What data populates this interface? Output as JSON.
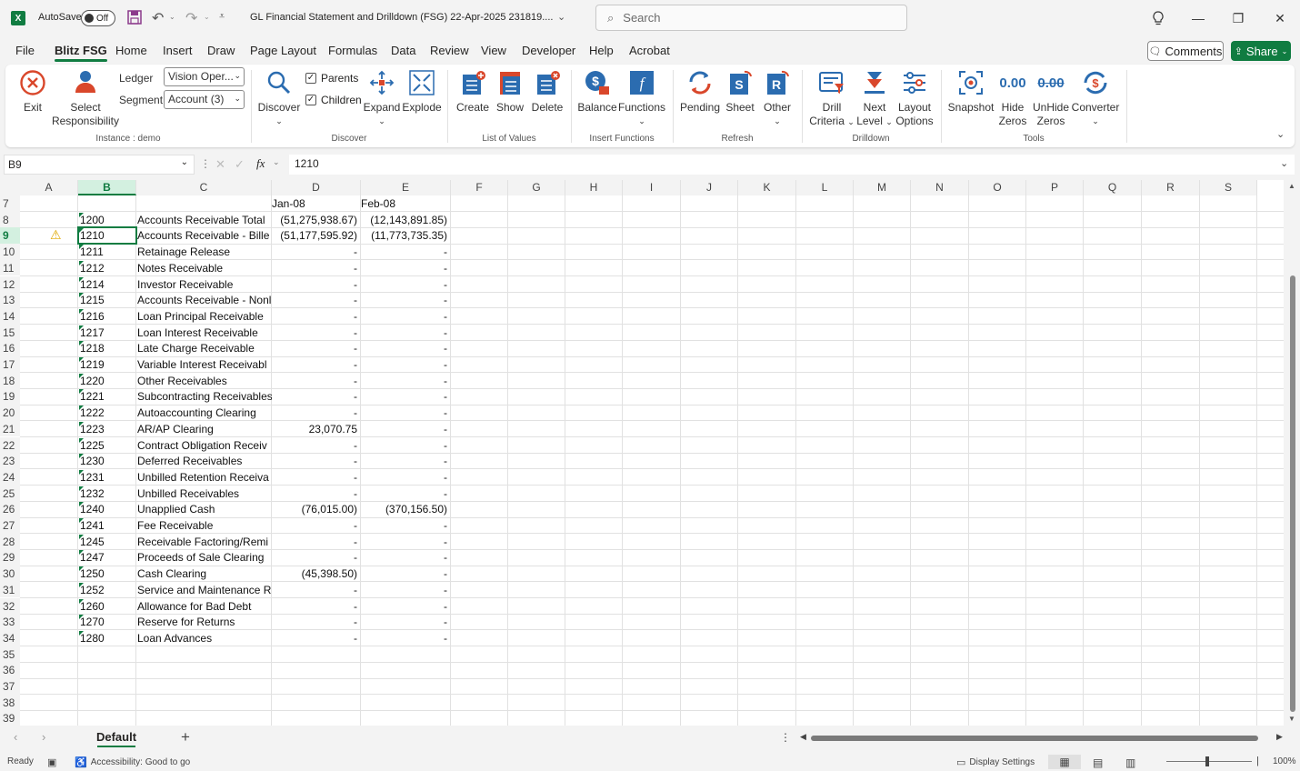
{
  "titlebar": {
    "autosave_label": "AutoSave",
    "autosave_state": "Off",
    "document_title": "GL Financial Statement and Drilldown (FSG) 22-Apr-2025 231819....",
    "search_placeholder": "Search"
  },
  "menu": {
    "tabs": [
      "File",
      "Blitz FSG",
      "Home",
      "Insert",
      "Draw",
      "Page Layout",
      "Formulas",
      "Data",
      "Review",
      "View",
      "Developer",
      "Help",
      "Acrobat"
    ],
    "active_tab": "Blitz FSG",
    "comments_label": "Comments",
    "share_label": "Share"
  },
  "ribbon": {
    "exit_label": "Exit",
    "select_resp_label1": "Select",
    "select_resp_label2": "Responsibility",
    "ledger_label": "Ledger",
    "ledger_value": "Vision Oper...",
    "segment_label": "Segment",
    "segment_value": "Account (3)",
    "instance_group": "Instance : demo",
    "discover_label": "Discover",
    "parents_label": "Parents",
    "children_label": "Children",
    "expand_label": "Expand",
    "explode_label": "Explode",
    "discover_group": "Discover",
    "create_label": "Create",
    "show_label": "Show",
    "delete_label": "Delete",
    "lov_group": "List of Values",
    "balance_label": "Balance",
    "functions_label": "Functions",
    "insert_functions_group": "Insert Functions",
    "pending_label": "Pending",
    "sheet_label": "Sheet",
    "other_label": "Other",
    "refresh_group": "Refresh",
    "drill_criteria_label1": "Drill",
    "drill_criteria_label2": "Criteria",
    "next_level_label1": "Next",
    "next_level_label2": "Level",
    "layout_options_label1": "Layout",
    "layout_options_label2": "Options",
    "drilldown_group": "Drilldown",
    "snapshot_label": "Snapshot",
    "hide_zeros_label1": "Hide",
    "hide_zeros_label2": "Zeros",
    "unhide_zeros_label1": "UnHide",
    "unhide_zeros_label2": "Zeros",
    "zeros_icon_text": "0.00",
    "converter_label": "Converter",
    "tools_group": "Tools"
  },
  "formula_bar": {
    "name_box": "B9",
    "formula": "1210"
  },
  "grid": {
    "columns": [
      "A",
      "B",
      "C",
      "D",
      "E",
      "F",
      "G",
      "H",
      "I",
      "J",
      "K",
      "L",
      "M",
      "N",
      "O",
      "P",
      "Q",
      "R",
      "S"
    ],
    "header_row": {
      "row": "7",
      "d": "Jan-08",
      "e": "Feb-08"
    },
    "rows": [
      {
        "row": "8",
        "b": "1200",
        "c": "Accounts Receivable Total",
        "d": "(51,275,938.67)",
        "e": "(12,143,891.85)"
      },
      {
        "row": "9",
        "b": "1210",
        "c": "Accounts Receivable - Bille",
        "d": "(51,177,595.92)",
        "e": "(11,773,735.35)"
      },
      {
        "row": "10",
        "b": "1211",
        "c": "Retainage Release",
        "d": "-",
        "e": "-"
      },
      {
        "row": "11",
        "b": "1212",
        "c": "Notes Receivable",
        "d": "-",
        "e": "-"
      },
      {
        "row": "12",
        "b": "1214",
        "c": "Investor Receivable",
        "d": "-",
        "e": "-"
      },
      {
        "row": "13",
        "b": "1215",
        "c": "Accounts Receivable - Nonl",
        "d": "-",
        "e": "-"
      },
      {
        "row": "14",
        "b": "1216",
        "c": "Loan Principal Receivable",
        "d": "-",
        "e": "-"
      },
      {
        "row": "15",
        "b": "1217",
        "c": "Loan Interest Receivable",
        "d": "-",
        "e": "-"
      },
      {
        "row": "16",
        "b": "1218",
        "c": "Late Charge Receivable",
        "d": "-",
        "e": "-"
      },
      {
        "row": "17",
        "b": "1219",
        "c": "Variable Interest Receivabl",
        "d": "-",
        "e": "-"
      },
      {
        "row": "18",
        "b": "1220",
        "c": "Other Receivables",
        "d": "-",
        "e": "-"
      },
      {
        "row": "19",
        "b": "1221",
        "c": "Subcontracting Receivables",
        "d": "-",
        "e": "-"
      },
      {
        "row": "20",
        "b": "1222",
        "c": "Autoaccounting Clearing",
        "d": "-",
        "e": "-"
      },
      {
        "row": "21",
        "b": "1223",
        "c": "AR/AP Clearing",
        "d": "23,070.75",
        "e": "-"
      },
      {
        "row": "22",
        "b": "1225",
        "c": "Contract Obligation Receiv",
        "d": "-",
        "e": "-"
      },
      {
        "row": "23",
        "b": "1230",
        "c": "Deferred Receivables",
        "d": "-",
        "e": "-"
      },
      {
        "row": "24",
        "b": "1231",
        "c": "Unbilled Retention Receiva",
        "d": "-",
        "e": "-"
      },
      {
        "row": "25",
        "b": "1232",
        "c": "Unbilled Receivables",
        "d": "-",
        "e": "-"
      },
      {
        "row": "26",
        "b": "1240",
        "c": "Unapplied Cash",
        "d": "(76,015.00)",
        "e": "(370,156.50)"
      },
      {
        "row": "27",
        "b": "1241",
        "c": "Fee Receivable",
        "d": "-",
        "e": "-"
      },
      {
        "row": "28",
        "b": "1245",
        "c": "Receivable Factoring/Remi",
        "d": "-",
        "e": "-"
      },
      {
        "row": "29",
        "b": "1247",
        "c": "Proceeds of Sale Clearing",
        "d": "-",
        "e": "-"
      },
      {
        "row": "30",
        "b": "1250",
        "c": "Cash Clearing",
        "d": "(45,398.50)",
        "e": "-"
      },
      {
        "row": "31",
        "b": "1252",
        "c": "Service and Maintenance R",
        "d": "-",
        "e": "-"
      },
      {
        "row": "32",
        "b": "1260",
        "c": "Allowance for Bad Debt",
        "d": "-",
        "e": "-"
      },
      {
        "row": "33",
        "b": "1270",
        "c": "Reserve for Returns",
        "d": "-",
        "e": "-"
      },
      {
        "row": "34",
        "b": "1280",
        "c": "Loan Advances",
        "d": "-",
        "e": "-"
      },
      {
        "row": "35"
      },
      {
        "row": "36"
      },
      {
        "row": "37"
      },
      {
        "row": "38"
      },
      {
        "row": "39"
      }
    ]
  },
  "sheets": {
    "active": "Default",
    "add_label": "+"
  },
  "statusbar": {
    "ready": "Ready",
    "accessibility": "Accessibility: Good to go",
    "display_settings": "Display Settings",
    "zoom": "100%"
  },
  "colors": {
    "accent": "#107c41",
    "ribbon_blue": "#2b6cb0",
    "ribbon_red": "#d9472b"
  }
}
